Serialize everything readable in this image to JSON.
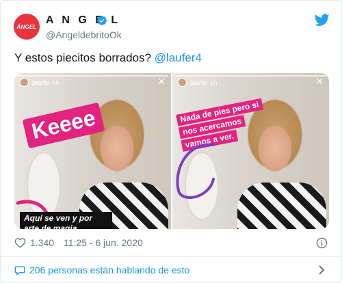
{
  "author": {
    "avatar_text": "ÁNGEL",
    "name": "A N G E L",
    "handle": "@AngeldebritoOk"
  },
  "tweet": {
    "text": "Y estos piecitos borrados? ",
    "mention": "@laufer4"
  },
  "media": {
    "left": {
      "user": "juariu",
      "time": "9h",
      "sticker": "Keeee",
      "caption": "Aquí se ven y por arte de magia"
    },
    "right": {
      "user": "juariu",
      "time": "9h",
      "caption_lines": [
        "Nada de pies pero si",
        "nos acercamos",
        "vamos  a ver."
      ]
    }
  },
  "meta": {
    "likes": "1.340",
    "timestamp": "11:25 - 6 jun. 2020"
  },
  "conversation": {
    "label": "206 personas están hablando de esto"
  },
  "colors": {
    "brand_blue": "#1b95e0",
    "avatar_red": "#e8343c",
    "sticker_pink": "#e2237f"
  },
  "icons": [
    "verified-icon",
    "twitter-bird-icon",
    "heart-icon",
    "info-icon",
    "speech-bubble-icon",
    "chevron-right-icon",
    "close-icon"
  ]
}
